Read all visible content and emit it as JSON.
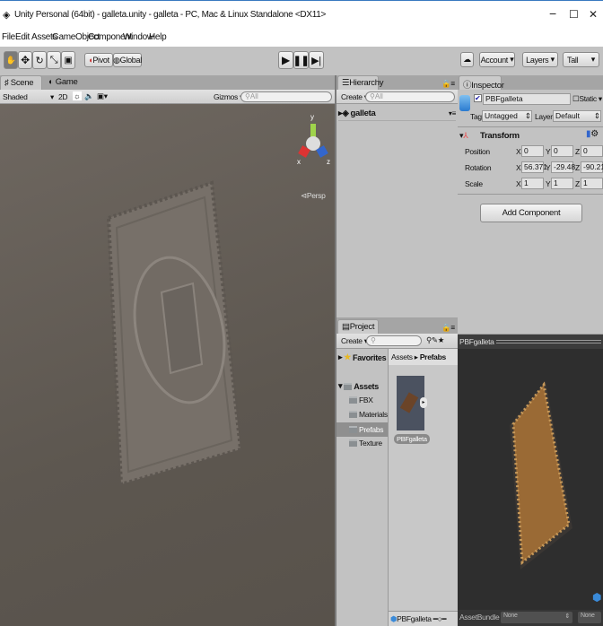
{
  "window": {
    "title": "Unity Personal (64bit) - galleta.unity - galleta - PC, Mac & Linux Standalone <DX11>",
    "minimize": "−",
    "maximize": "☐",
    "close": "✕"
  },
  "menu": [
    "File",
    "Edit",
    "Assets",
    "GameObject",
    "Component",
    "Window",
    "Help"
  ],
  "toolbar": {
    "pivot": "Pivot",
    "global": "Global",
    "account": "Account",
    "layers": "Layers",
    "layout": "Tall"
  },
  "scene": {
    "tab_scene": "Scene",
    "tab_game": "Game",
    "shading": "Shaded",
    "mode2d": "2D",
    "gizmos": "Gizmos",
    "search_placeholder": "All",
    "persp": "Persp",
    "axis_x": "x",
    "axis_y": "y",
    "axis_z": "z"
  },
  "hierarchy": {
    "tab": "Hierarchy",
    "create": "Create",
    "search_placeholder": "All",
    "root": "galleta"
  },
  "inspector": {
    "tab": "Inspector",
    "object_name": "PBFgalleta",
    "static": "Static",
    "tag_label": "Tag",
    "tag": "Untagged",
    "layer_label": "Layer",
    "layer": "Default",
    "component": "Transform",
    "rows": [
      {
        "label": "Position",
        "x": "0",
        "y": "0",
        "z": "0"
      },
      {
        "label": "Rotation",
        "x": "56.371",
        "y": "-29.48",
        "z": "-90.214"
      },
      {
        "label": "Scale",
        "x": "1",
        "y": "1",
        "z": "1"
      }
    ],
    "add_component": "Add Component"
  },
  "project": {
    "tab": "Project",
    "create": "Create",
    "favorites": "Favorites",
    "assets": "Assets",
    "folders": [
      "FBX",
      "Materials",
      "Prefabs",
      "Texture"
    ],
    "breadcrumb_root": "Assets",
    "breadcrumb_current": "Prefabs",
    "asset": "PBFgalleta",
    "footer_asset": "PBFgalleta"
  },
  "preview": {
    "title": "PBFgalleta",
    "assetbundle_label": "AssetBundle",
    "bundle": "None",
    "variant": "None"
  }
}
